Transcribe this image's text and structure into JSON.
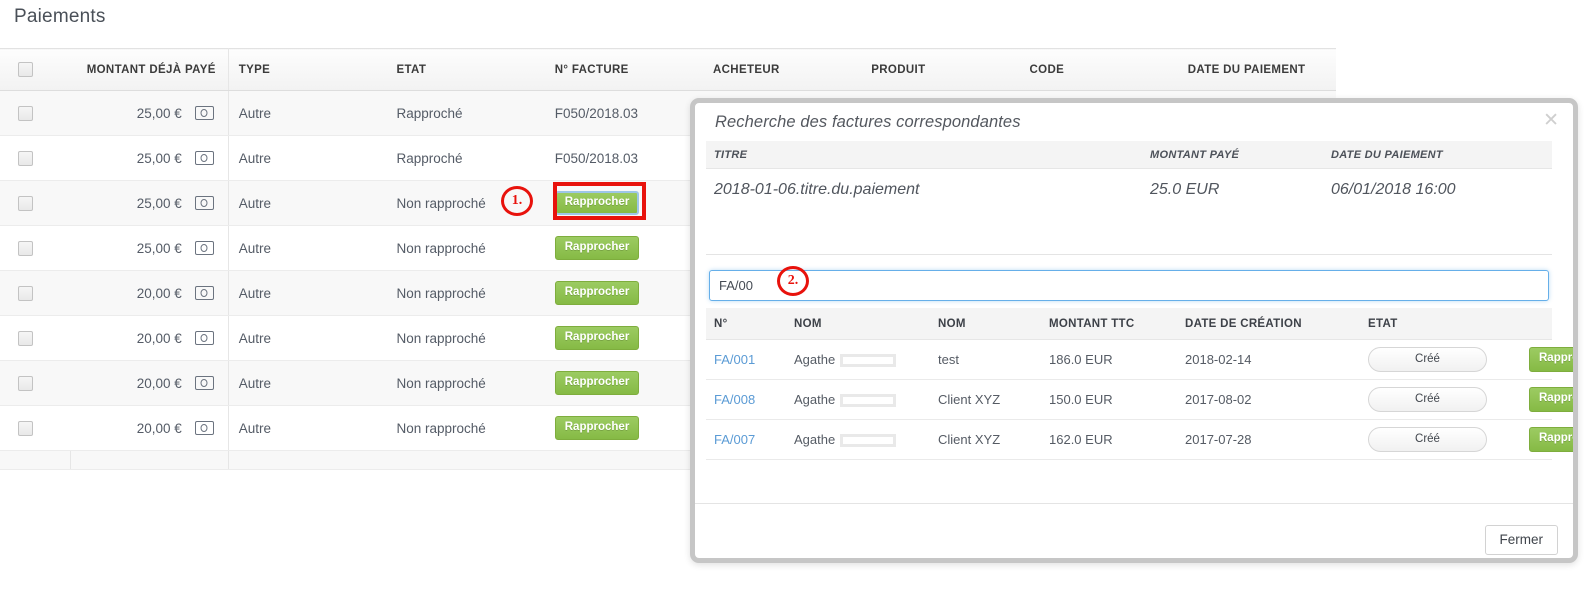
{
  "page": {
    "title": "Paiements"
  },
  "payments_table": {
    "columns": [
      "MONTANT DÉJÀ PAYÉ",
      "TYPE",
      "ETAT",
      "N° FACTURE",
      "ACHETEUR",
      "PRODUIT",
      "CODE",
      "DATE DU PAIEMENT"
    ],
    "action_label": "Rapprocher",
    "rows": [
      {
        "amount": "25,00 €",
        "type": "Autre",
        "etat": "Rapproché",
        "facture": "F050/2018.03",
        "acheteur": "",
        "produit": "",
        "code": "",
        "date": "",
        "has_action": false
      },
      {
        "amount": "25,00 €",
        "type": "Autre",
        "etat": "Rapproché",
        "facture": "F050/2018.03",
        "acheteur": "",
        "produit": "",
        "code": "",
        "date": "",
        "has_action": false
      },
      {
        "amount": "25,00 €",
        "type": "Autre",
        "etat": "Non rapproché",
        "facture": "",
        "acheteur": "",
        "produit": "",
        "code": "",
        "date": "",
        "has_action": true
      },
      {
        "amount": "25,00 €",
        "type": "Autre",
        "etat": "Non rapproché",
        "facture": "",
        "acheteur": "",
        "produit": "",
        "code": "",
        "date": "",
        "has_action": true
      },
      {
        "amount": "20,00 €",
        "type": "Autre",
        "etat": "Non rapproché",
        "facture": "",
        "acheteur": "",
        "produit": "",
        "code": "",
        "date": "",
        "has_action": true
      },
      {
        "amount": "20,00 €",
        "type": "Autre",
        "etat": "Non rapproché",
        "facture": "",
        "acheteur": "",
        "produit": "",
        "code": "",
        "date": "",
        "has_action": true
      },
      {
        "amount": "20,00 €",
        "type": "Autre",
        "etat": "Non rapproché",
        "facture": "",
        "acheteur": "",
        "produit": "",
        "code": "",
        "date": "",
        "has_action": true
      },
      {
        "amount": "20,00 €",
        "type": "Autre",
        "etat": "Non rapproché",
        "facture": "",
        "acheteur": "",
        "produit": "",
        "code": "",
        "date": "",
        "has_action": true
      }
    ]
  },
  "annotations": {
    "marker_1": "1.",
    "marker_2": "2.",
    "highlight_color": "#e8120c"
  },
  "modal": {
    "title": "Recherche des factures correspondantes",
    "close_icon": "close-icon",
    "payment_info": {
      "columns": [
        "TITRE",
        "MONTANT PAYÉ",
        "DATE DU PAIEMENT"
      ],
      "titre": "2018-01-06.titre.du.paiement",
      "montant_paye": "25.0 EUR",
      "date_du_paiement": "06/01/2018 16:00"
    },
    "search": {
      "value": "FA/00",
      "placeholder": ""
    },
    "results": {
      "columns": [
        "N°",
        "NOM",
        "NOM",
        "MONTANT TTC",
        "DATE DE CRÉATION",
        "ETAT"
      ],
      "action_label": "Rapprocher",
      "rows": [
        {
          "num": "FA/001",
          "nom1": "Agathe",
          "nom2": "test",
          "montant_ttc": "186.0 EUR",
          "date_creation": "2018-02-14",
          "etat": "Créé"
        },
        {
          "num": "FA/008",
          "nom1": "Agathe",
          "nom2": "Client XYZ",
          "montant_ttc": "150.0 EUR",
          "date_creation": "2017-08-02",
          "etat": "Créé"
        },
        {
          "num": "FA/007",
          "nom1": "Agathe",
          "nom2": "Client XYZ",
          "montant_ttc": "162.0 EUR",
          "date_creation": "2017-07-28",
          "etat": "Créé"
        }
      ]
    },
    "footer": {
      "close_label": "Fermer"
    }
  },
  "colors": {
    "green_button": "#8cc152",
    "link_blue": "#5b9bd5",
    "annotation_red": "#e8120c"
  }
}
